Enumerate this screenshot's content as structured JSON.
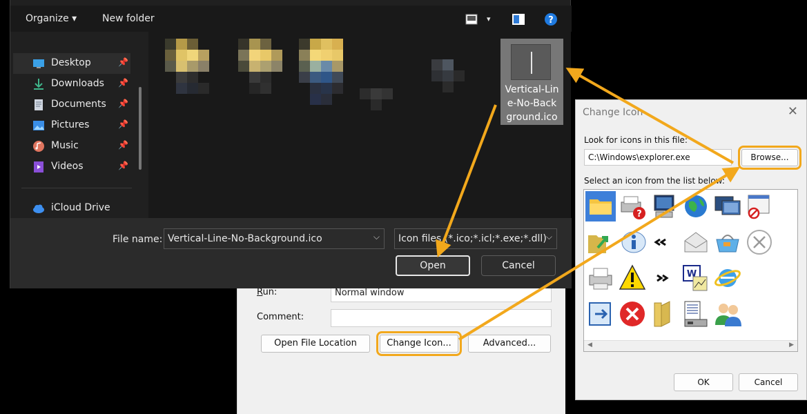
{
  "explorer": {
    "toolbar": {
      "organize": "Organize",
      "new_folder": "New folder"
    },
    "nav": [
      {
        "label": "Desktop",
        "icon": "desktop-icon",
        "pinned": true
      },
      {
        "label": "Downloads",
        "icon": "download-icon",
        "pinned": true
      },
      {
        "label": "Documents",
        "icon": "documents-icon",
        "pinned": true
      },
      {
        "label": "Pictures",
        "icon": "pictures-icon",
        "pinned": true
      },
      {
        "label": "Music",
        "icon": "music-icon",
        "pinned": true
      },
      {
        "label": "Videos",
        "icon": "videos-icon",
        "pinned": true
      },
      {
        "label": "iCloud Drive",
        "icon": "cloud-icon",
        "pinned": false
      }
    ],
    "selected_file": {
      "name": "Vertical-Line-No-Background.ico",
      "name_lines": [
        "Vertical-Lin",
        "e-No-Back",
        "ground.ico"
      ]
    },
    "file_name_label": "File name:",
    "file_name_value": "Vertical-Line-No-Background.ico",
    "filter": "Icon files (*.ico;*.icl;*.exe;*.dll)",
    "open": "Open",
    "cancel": "Cancel"
  },
  "shortcut_props": {
    "run_label": "Run:",
    "run_value": "Normal window",
    "comment_label": "Comment:",
    "comment_value": "",
    "open_location": "Open File Location",
    "change_icon": "Change Icon...",
    "advanced": "Advanced..."
  },
  "change_icon": {
    "title": "Change Icon",
    "look_label": "Look for icons in this file:",
    "path": "C:\\Windows\\explorer.exe",
    "browse": "Browse...",
    "select_label": "Select an icon from the list below:",
    "ok": "OK",
    "cancel": "Cancel",
    "icons": [
      "folder-icon",
      "printer-error-icon",
      "monitor-icon",
      "globe-icon",
      "network-icon",
      "window-blocked-icon",
      "folder-arrow-icon",
      "info-icon",
      "rewind-icon",
      "envelope-icon",
      "shopping-basket-icon",
      "cancel-circle-icon",
      "printer-icon",
      "warning-icon",
      "fast-forward-icon",
      "document-chart-icon",
      "internet-explorer-icon",
      "exit-icon",
      "error-icon",
      "folder-open-icon",
      "computer-list-icon",
      "users-icon"
    ]
  },
  "colors": {
    "highlight": "#f2a81c",
    "dark_bg": "#202020",
    "light_bg": "#f0f0f0"
  }
}
